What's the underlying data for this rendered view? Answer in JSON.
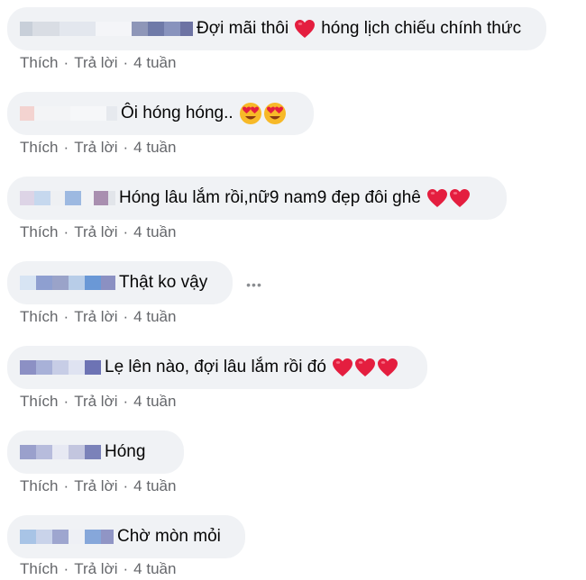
{
  "actions": {
    "like": "Thích",
    "reply": "Trả lời",
    "time": "4 tuần"
  },
  "comments": [
    {
      "text": "Đợi mãi thôi",
      "text_after": "hóng lịch chiếu chính thức"
    },
    {
      "text": "Ôi hóng hóng.."
    },
    {
      "text": "Hóng lâu lắm rồi,nữ9 nam9 đẹp đôi ghê"
    },
    {
      "text": "Thật ko vậy"
    },
    {
      "text": "Lẹ lên nào, đợi lâu lắm rồi đó"
    },
    {
      "text": "Hóng"
    },
    {
      "text": "Chờ mòn mỏi"
    }
  ],
  "colors": {
    "bubble": "#f0f2f5",
    "meta_text": "#65676b",
    "heart": "#e41e3f"
  },
  "icons": {
    "heart": "red-heart-icon",
    "heart_eyes": "heart-eyes-emoji-icon",
    "more": "more-options-icon"
  }
}
